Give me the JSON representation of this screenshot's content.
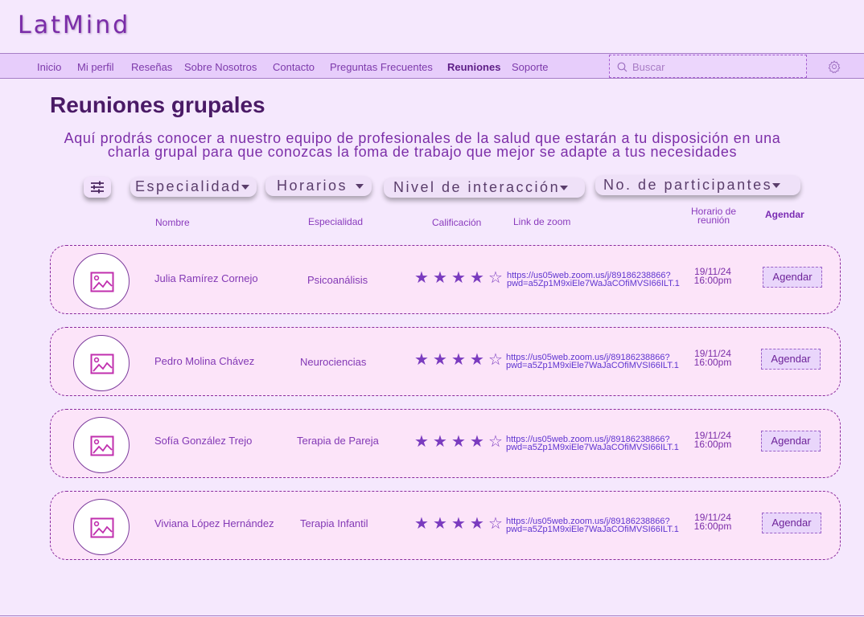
{
  "brand": {
    "name": "LatMind"
  },
  "nav": {
    "items": [
      {
        "label": "Inicio"
      },
      {
        "label": "Mi perfil"
      },
      {
        "label": "Reseñas"
      },
      {
        "label": "Sobre Nosotros"
      },
      {
        "label": "Contacto"
      },
      {
        "label": "Preguntas Frecuentes"
      },
      {
        "label": "Reuniones",
        "active": true
      },
      {
        "label": "Soporte"
      }
    ],
    "search_placeholder": "Buscar",
    "settings_icon": "gear-icon"
  },
  "page": {
    "title": "Reuniones grupales",
    "intro_line1": "Aquí prodrás conocer a nuestro equipo de profesionales de la salud que estarán a tu disposición en una",
    "intro_line2": "charla grupal para que conozcas la foma de trabajo que mejor se adapte a tus necesidades"
  },
  "filters": {
    "icon": "sliders-icon",
    "items": [
      {
        "label": "Especialidad"
      },
      {
        "label": "Horarios"
      },
      {
        "label": "Nivel de interacción"
      },
      {
        "label": "No. de participantes"
      }
    ]
  },
  "columns": {
    "name": "Nombre",
    "specialty": "Especialidad",
    "rating": "Calificación",
    "zoom": "Link de zoom",
    "time_line1": "Horario de",
    "time_line2": "reunión",
    "schedule": "Agendar"
  },
  "rows": [
    {
      "name": "Julia Ramírez Cornejo",
      "specialty": "Psicoanálisis",
      "rating": 4,
      "rating_max": 5,
      "zoom_line1": "https://us05web.zoom.us/j/89186238866?",
      "zoom_line2": "pwd=a5Zp1M9xiEle7WaJaCOfiMVSI66ILT.1",
      "date": "19/11/24",
      "time": "16:00pm",
      "button": "Agendar"
    },
    {
      "name": "Pedro Molina Chávez",
      "specialty": "Neurociencias",
      "rating": 4,
      "rating_max": 5,
      "zoom_line1": "https://us05web.zoom.us/j/89186238866?",
      "zoom_line2": "pwd=a5Zp1M9xiEle7WaJaCOfiMVSI66ILT.1",
      "date": "19/11/24",
      "time": "16:00pm",
      "button": "Agendar"
    },
    {
      "name": "Sofía González Trejo",
      "specialty": "Terapia de Pareja",
      "rating": 4,
      "rating_max": 5,
      "zoom_line1": "https://us05web.zoom.us/j/89186238866?",
      "zoom_line2": "pwd=a5Zp1M9xiEle7WaJaCOfiMVSI66ILT.1",
      "date": "19/11/24",
      "time": "16:00pm",
      "button": "Agendar"
    },
    {
      "name": "Viviana López Hernández",
      "specialty": "Terapia Infantil",
      "rating": 4,
      "rating_max": 5,
      "zoom_line1": "https://us05web.zoom.us/j/89186238866?",
      "zoom_line2": "pwd=a5Zp1M9xiEle7WaJaCOfiMVSI66ILT.1",
      "date": "19/11/24",
      "time": "16:00pm",
      "button": "Agendar"
    }
  ],
  "colors": {
    "background": "#f5e8fd",
    "navbar": "#e7cdfb",
    "card": "#fce4f9",
    "accent": "#7a3bbf",
    "link": "#6036d0"
  }
}
